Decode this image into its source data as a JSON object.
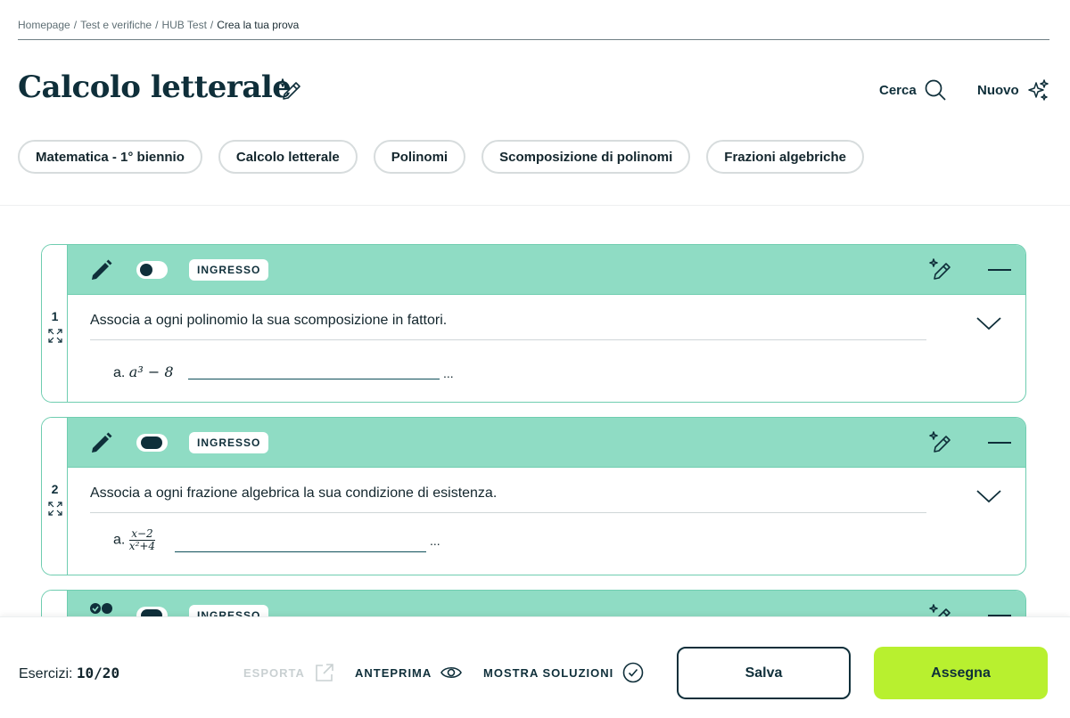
{
  "breadcrumb": [
    "Homepage",
    "Test e verifiche",
    "HUB Test",
    "Crea la tua prova"
  ],
  "breadcrumb_separator": "/",
  "title": "Calcolo letterale",
  "actions": {
    "search_label": "Cerca",
    "new_label": "Nuovo"
  },
  "chips": [
    "Matematica - 1° biennio",
    "Calcolo letterale",
    "Polinomi",
    "Scomposizione di polinomi",
    "Frazioni algebriche"
  ],
  "exercises": [
    {
      "number": "1",
      "tag": "INGRESSO",
      "toggle_on": false,
      "question": "Associa a ogni polinomio la sua scomposizione in fattori.",
      "answer_prefix": "a.",
      "answer_math": "a³ − 8",
      "answer_suffix": "..."
    },
    {
      "number": "2",
      "tag": "INGRESSO",
      "toggle_on": true,
      "question": "Associa a ogni frazione algebrica la sua condizione di esistenza.",
      "answer_prefix": "a.",
      "answer_numerator": "x−2",
      "answer_denominator": "x²+4",
      "answer_suffix": "..."
    },
    {
      "tag": "INGRESSO"
    }
  ],
  "footer": {
    "exercises_label": "Esercizi:",
    "exercises_count": "10/20",
    "export_label": "ESPORTA",
    "preview_label": "ANTEPRIMA",
    "solutions_label": "MOSTRA SOLUZIONI",
    "save_label": "Salva",
    "assign_label": "Assegna"
  },
  "colors": {
    "primary": "#0f2f3a",
    "card_header": "#8fdcc4",
    "card_border": "#6fcdb0",
    "assign_button": "#b8f02f"
  }
}
